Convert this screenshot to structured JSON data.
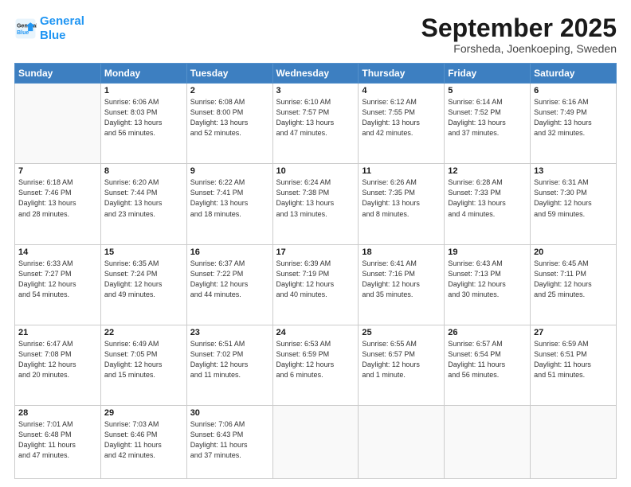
{
  "header": {
    "logo_line1": "General",
    "logo_line2": "Blue",
    "month": "September 2025",
    "location": "Forsheda, Joenkoeping, Sweden"
  },
  "weekdays": [
    "Sunday",
    "Monday",
    "Tuesday",
    "Wednesday",
    "Thursday",
    "Friday",
    "Saturday"
  ],
  "weeks": [
    [
      {
        "day": "",
        "info": ""
      },
      {
        "day": "1",
        "info": "Sunrise: 6:06 AM\nSunset: 8:03 PM\nDaylight: 13 hours\nand 56 minutes."
      },
      {
        "day": "2",
        "info": "Sunrise: 6:08 AM\nSunset: 8:00 PM\nDaylight: 13 hours\nand 52 minutes."
      },
      {
        "day": "3",
        "info": "Sunrise: 6:10 AM\nSunset: 7:57 PM\nDaylight: 13 hours\nand 47 minutes."
      },
      {
        "day": "4",
        "info": "Sunrise: 6:12 AM\nSunset: 7:55 PM\nDaylight: 13 hours\nand 42 minutes."
      },
      {
        "day": "5",
        "info": "Sunrise: 6:14 AM\nSunset: 7:52 PM\nDaylight: 13 hours\nand 37 minutes."
      },
      {
        "day": "6",
        "info": "Sunrise: 6:16 AM\nSunset: 7:49 PM\nDaylight: 13 hours\nand 32 minutes."
      }
    ],
    [
      {
        "day": "7",
        "info": "Sunrise: 6:18 AM\nSunset: 7:46 PM\nDaylight: 13 hours\nand 28 minutes."
      },
      {
        "day": "8",
        "info": "Sunrise: 6:20 AM\nSunset: 7:44 PM\nDaylight: 13 hours\nand 23 minutes."
      },
      {
        "day": "9",
        "info": "Sunrise: 6:22 AM\nSunset: 7:41 PM\nDaylight: 13 hours\nand 18 minutes."
      },
      {
        "day": "10",
        "info": "Sunrise: 6:24 AM\nSunset: 7:38 PM\nDaylight: 13 hours\nand 13 minutes."
      },
      {
        "day": "11",
        "info": "Sunrise: 6:26 AM\nSunset: 7:35 PM\nDaylight: 13 hours\nand 8 minutes."
      },
      {
        "day": "12",
        "info": "Sunrise: 6:28 AM\nSunset: 7:33 PM\nDaylight: 13 hours\nand 4 minutes."
      },
      {
        "day": "13",
        "info": "Sunrise: 6:31 AM\nSunset: 7:30 PM\nDaylight: 12 hours\nand 59 minutes."
      }
    ],
    [
      {
        "day": "14",
        "info": "Sunrise: 6:33 AM\nSunset: 7:27 PM\nDaylight: 12 hours\nand 54 minutes."
      },
      {
        "day": "15",
        "info": "Sunrise: 6:35 AM\nSunset: 7:24 PM\nDaylight: 12 hours\nand 49 minutes."
      },
      {
        "day": "16",
        "info": "Sunrise: 6:37 AM\nSunset: 7:22 PM\nDaylight: 12 hours\nand 44 minutes."
      },
      {
        "day": "17",
        "info": "Sunrise: 6:39 AM\nSunset: 7:19 PM\nDaylight: 12 hours\nand 40 minutes."
      },
      {
        "day": "18",
        "info": "Sunrise: 6:41 AM\nSunset: 7:16 PM\nDaylight: 12 hours\nand 35 minutes."
      },
      {
        "day": "19",
        "info": "Sunrise: 6:43 AM\nSunset: 7:13 PM\nDaylight: 12 hours\nand 30 minutes."
      },
      {
        "day": "20",
        "info": "Sunrise: 6:45 AM\nSunset: 7:11 PM\nDaylight: 12 hours\nand 25 minutes."
      }
    ],
    [
      {
        "day": "21",
        "info": "Sunrise: 6:47 AM\nSunset: 7:08 PM\nDaylight: 12 hours\nand 20 minutes."
      },
      {
        "day": "22",
        "info": "Sunrise: 6:49 AM\nSunset: 7:05 PM\nDaylight: 12 hours\nand 15 minutes."
      },
      {
        "day": "23",
        "info": "Sunrise: 6:51 AM\nSunset: 7:02 PM\nDaylight: 12 hours\nand 11 minutes."
      },
      {
        "day": "24",
        "info": "Sunrise: 6:53 AM\nSunset: 6:59 PM\nDaylight: 12 hours\nand 6 minutes."
      },
      {
        "day": "25",
        "info": "Sunrise: 6:55 AM\nSunset: 6:57 PM\nDaylight: 12 hours\nand 1 minute."
      },
      {
        "day": "26",
        "info": "Sunrise: 6:57 AM\nSunset: 6:54 PM\nDaylight: 11 hours\nand 56 minutes."
      },
      {
        "day": "27",
        "info": "Sunrise: 6:59 AM\nSunset: 6:51 PM\nDaylight: 11 hours\nand 51 minutes."
      }
    ],
    [
      {
        "day": "28",
        "info": "Sunrise: 7:01 AM\nSunset: 6:48 PM\nDaylight: 11 hours\nand 47 minutes."
      },
      {
        "day": "29",
        "info": "Sunrise: 7:03 AM\nSunset: 6:46 PM\nDaylight: 11 hours\nand 42 minutes."
      },
      {
        "day": "30",
        "info": "Sunrise: 7:06 AM\nSunset: 6:43 PM\nDaylight: 11 hours\nand 37 minutes."
      },
      {
        "day": "",
        "info": ""
      },
      {
        "day": "",
        "info": ""
      },
      {
        "day": "",
        "info": ""
      },
      {
        "day": "",
        "info": ""
      }
    ]
  ]
}
